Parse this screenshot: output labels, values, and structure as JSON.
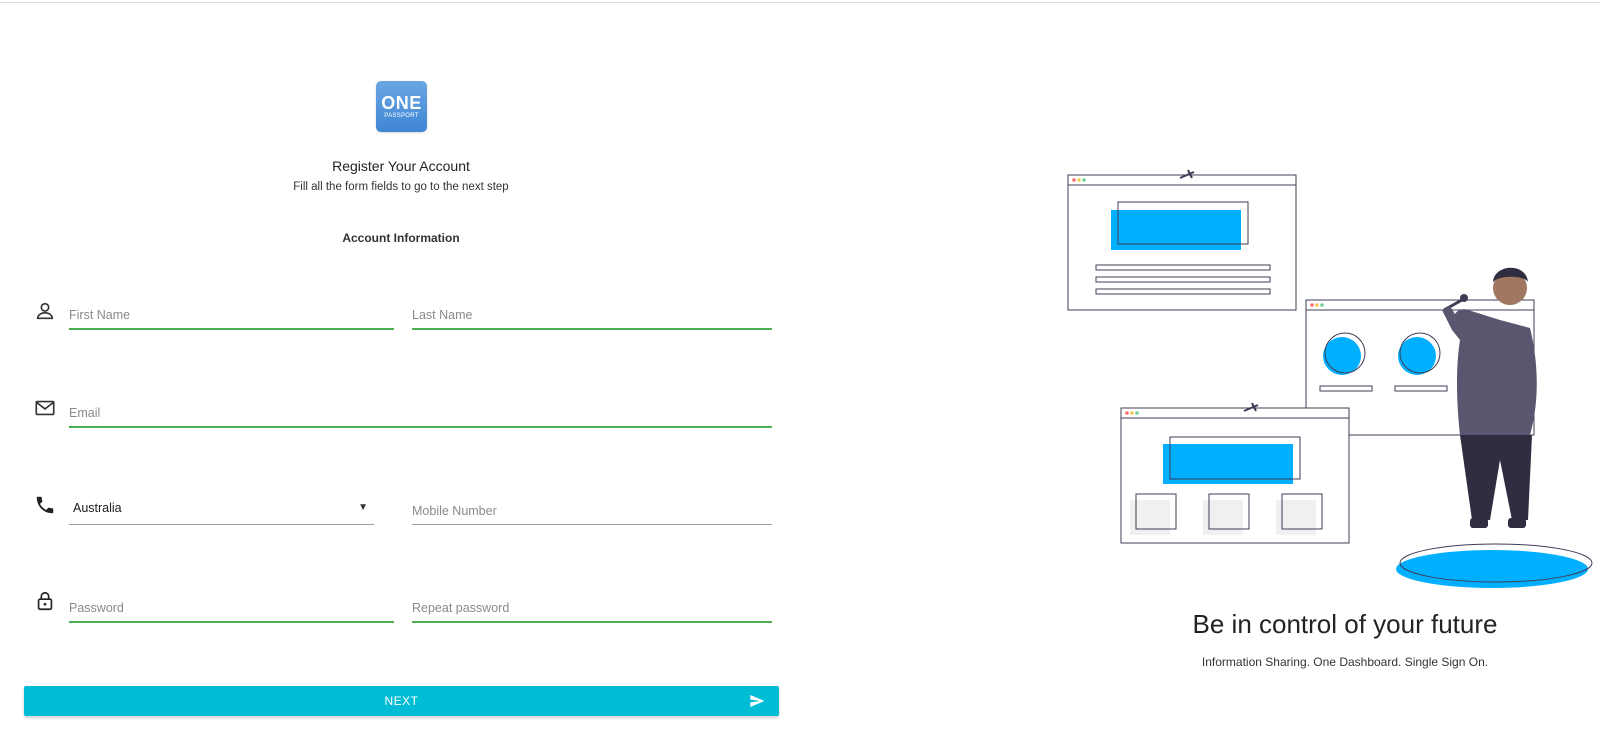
{
  "brand": {
    "logo_top": "ONE",
    "logo_bottom": "PASSPORT",
    "logo_color": "#4a90d9",
    "accent": "#00bcd4",
    "field_underline": "#4caf50",
    "illustration_accent": "#00b0ff"
  },
  "form": {
    "title": "Register Your Account",
    "subtitle": "Fill all the form fields to go to the next step",
    "section": "Account Information",
    "first_name": {
      "placeholder": "First Name",
      "value": ""
    },
    "last_name": {
      "placeholder": "Last Name",
      "value": ""
    },
    "email": {
      "placeholder": "Email",
      "value": ""
    },
    "country": {
      "selected": "Australia"
    },
    "mobile": {
      "placeholder": "Mobile Number",
      "value": ""
    },
    "password": {
      "placeholder": "Password",
      "value": ""
    },
    "repeat_password": {
      "placeholder": "Repeat password",
      "value": ""
    },
    "next_label": "NEXT"
  },
  "icons": {
    "name": "person-icon",
    "email": "envelope-icon",
    "phone": "phone-icon",
    "password": "lock-icon",
    "country_dropdown": "triangle-down-icon",
    "next": "send-icon"
  },
  "promo": {
    "title": "Be in control of your future",
    "subtitle": "Information Sharing. One Dashboard. Single Sign On."
  }
}
